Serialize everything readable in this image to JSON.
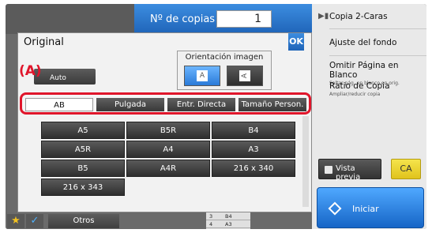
{
  "header": {
    "copies_label": "Nº de copias",
    "copies_value": "1"
  },
  "dialog": {
    "title": "Original",
    "ok_label": "OK",
    "callout_label": "(A)",
    "auto_label": "Auto",
    "orientation_label": "Orientación imagen",
    "orientation_icon_a": "A",
    "orientation_icon_b": "A",
    "tabs": [
      "AB",
      "Pulgada",
      "Entr. Directa",
      "Tamaño Person."
    ],
    "active_tab": "AB",
    "sizes": [
      "A5",
      "B5R",
      "B4",
      "A5R",
      "A4",
      "A3",
      "B5",
      "A4R",
      "216 x 340",
      "216 x 343"
    ]
  },
  "right_panel": {
    "items": [
      {
        "main": "Copia 2-Caras",
        "sub": ""
      },
      {
        "main": "Ajuste del fondo",
        "sub": ""
      },
      {
        "main": "Omitir Página en Blanco",
        "sub": "Saltar pág. en blanco en orig."
      },
      {
        "main": "Ratio de Copia",
        "sub": "Ampliar/reducir copia"
      }
    ],
    "preview_label": "Vista previa",
    "ca_label": "CA",
    "start_label": "Iniciar"
  },
  "bottom_bar": {
    "otros_label": "Otros",
    "mini_list": [
      {
        "num": "3",
        "label": "B4"
      },
      {
        "num": "4",
        "label": "A3"
      }
    ]
  },
  "colors": {
    "accent_blue": "#1f64b8",
    "callout_red": "#e0162b",
    "ca_yellow": "#e0c31c"
  },
  "icons": [
    "star-icon",
    "check-icon",
    "start-icon",
    "preview-icon",
    "expand-arrow-icon"
  ]
}
